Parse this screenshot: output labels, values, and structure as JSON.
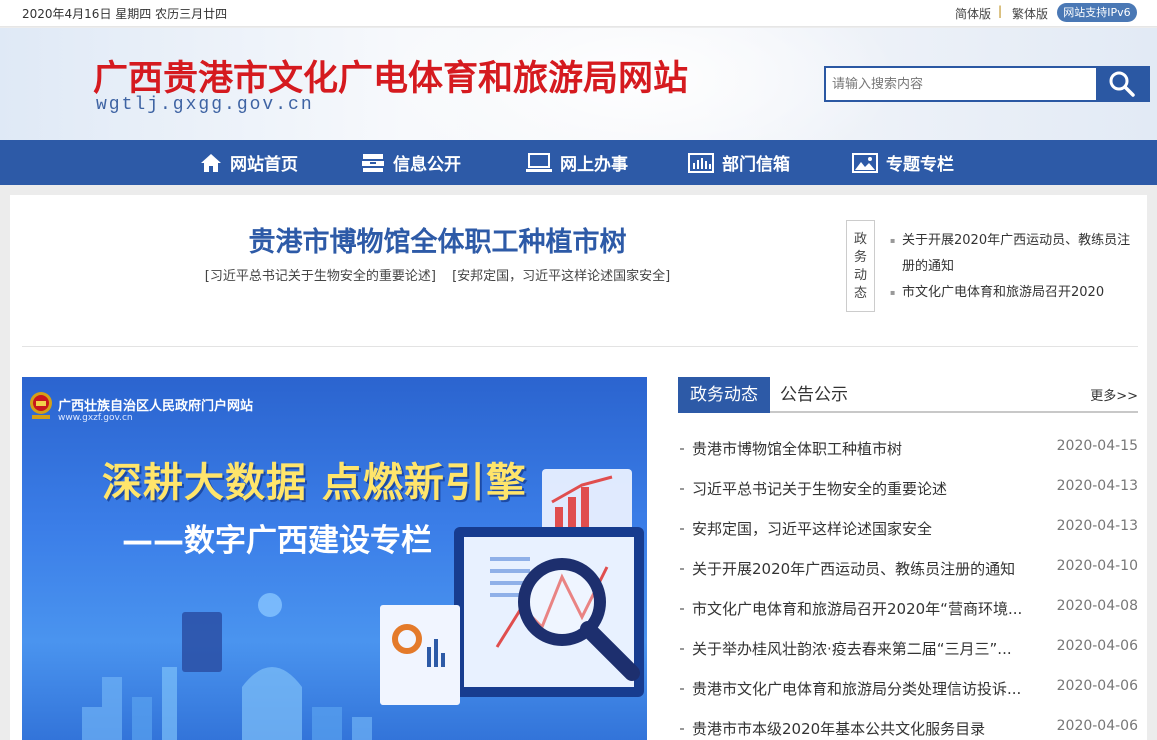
{
  "topbar": {
    "date": "2020年4月16日  星期四  农历三月廿四",
    "simplified": "简体版",
    "separator": "|",
    "traditional": "繁体版",
    "ipv6": "网站支持IPv6"
  },
  "header": {
    "title": "广西贵港市文化广电体育和旅游局网站",
    "domain": "wgtlj.gxgg.gov.cn",
    "search_placeholder": "请输入搜索内容"
  },
  "nav": {
    "items": [
      {
        "label": "网站首页",
        "icon": "home-icon"
      },
      {
        "label": "信息公开",
        "icon": "info-icon"
      },
      {
        "label": "网上办事",
        "icon": "computer-icon"
      },
      {
        "label": "部门信箱",
        "icon": "mailbox-icon"
      },
      {
        "label": "专题专栏",
        "icon": "image-icon"
      }
    ]
  },
  "headline": {
    "title": "贵港市博物馆全体职工种植市树",
    "links": [
      "[习近平总书记关于生物安全的重要论述]",
      "[安邦定国，习近平这样论述国家安全]"
    ]
  },
  "side_news": {
    "tag": "政务动态",
    "items": [
      "关于开展2020年广西运动员、教练员注册的通知",
      "市文化广电体育和旅游局召开2020"
    ]
  },
  "banner": {
    "source": "广西壮族自治区人民政府门户网站",
    "source_url": "www.gxzf.gov.cn",
    "line1": "深耕大数据 点燃新引擎",
    "line2": "——数字广西建设专栏"
  },
  "tabs": {
    "active": "政务动态",
    "inactive": "公告公示",
    "more": "更多>>"
  },
  "news": [
    {
      "title": "贵港市博物馆全体职工种植市树",
      "date": "2020-04-15"
    },
    {
      "title": "习近平总书记关于生物安全的重要论述",
      "date": "2020-04-13"
    },
    {
      "title": "安邦定国，习近平这样论述国家安全",
      "date": "2020-04-13"
    },
    {
      "title": "关于开展2020年广西运动员、教练员注册的通知",
      "date": "2020-04-10"
    },
    {
      "title": "市文化广电体育和旅游局召开2020年“营商环境...",
      "date": "2020-04-08"
    },
    {
      "title": "关于举办桂风壮韵浓·疫去春来第二届“三月三”...",
      "date": "2020-04-06"
    },
    {
      "title": "贵港市文化广电体育和旅游局分类处理信访投诉...",
      "date": "2020-04-06"
    },
    {
      "title": "贵港市市本级2020年基本公共文化服务目录",
      "date": "2020-04-06"
    }
  ],
  "colors": {
    "brand_blue": "#2d5aa7",
    "title_red": "#d51a1f",
    "banner_yellow": "#ffe56b"
  }
}
